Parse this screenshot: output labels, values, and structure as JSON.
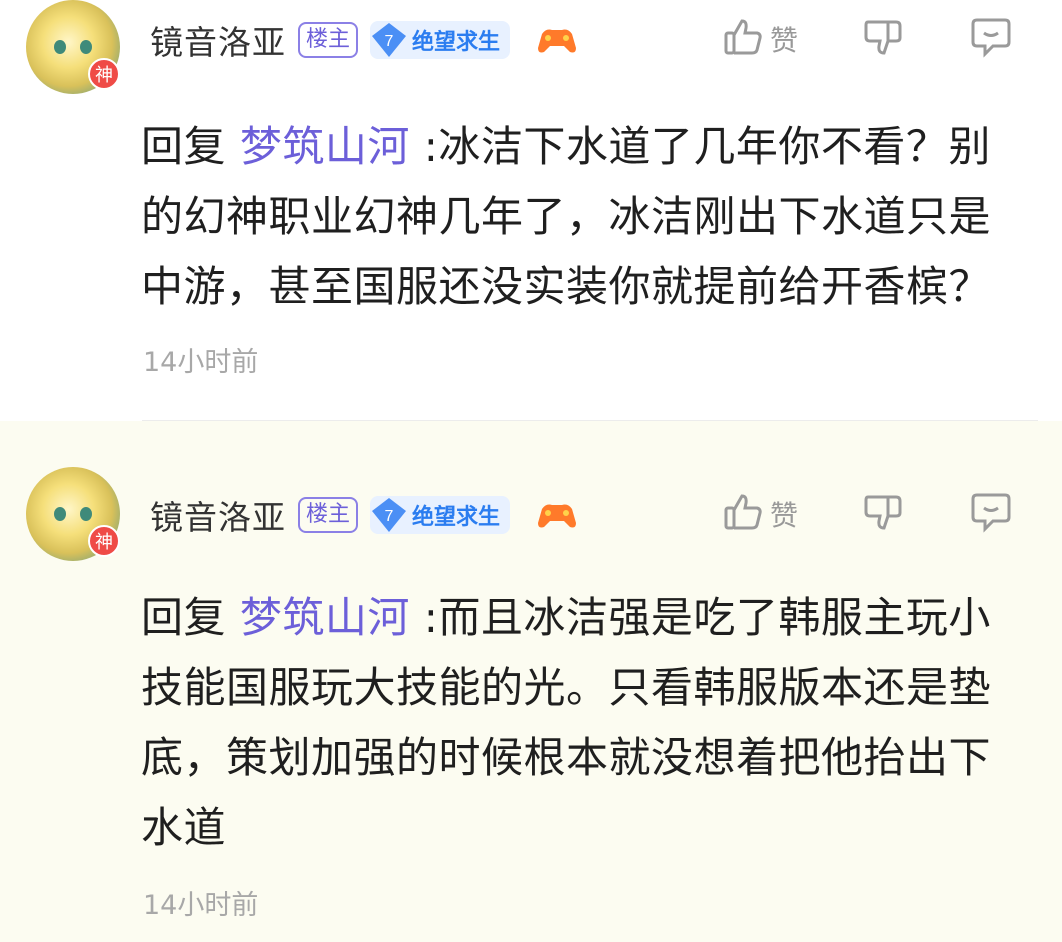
{
  "replies": [
    {
      "username": "镜音洛亚",
      "avatar_badge": "神",
      "owner_tag": "楼主",
      "level_number": "7",
      "level_name": "绝望求生",
      "like_label": "赞",
      "reply_prefix": "回复",
      "mention": "梦筑山河",
      "text": ":冰洁下水道了几年你不看？别的幻神职业幻神几年了，冰洁刚出下水道只是中游，甚至国服还没实装你就提前给开香槟？",
      "time": "14小时前"
    },
    {
      "username": "镜音洛亚",
      "avatar_badge": "神",
      "owner_tag": "楼主",
      "level_number": "7",
      "level_name": "绝望求生",
      "like_label": "赞",
      "reply_prefix": "回复",
      "mention": "梦筑山河",
      "text": ":而且冰洁强是吃了韩服主玩小技能国服玩大技能的光。只看韩服版本还是垫底，策划加强的时候根本就没想着把他抬出下水道",
      "time": "14小时前"
    }
  ],
  "colors": {
    "accent": "#6c5fd9",
    "level": "#2b7df0",
    "badge": "#ef4b47",
    "second_bg": "#fcfcf1"
  },
  "icons": [
    "thumbs-up-icon",
    "thumbs-down-icon",
    "comment-icon",
    "gamepad-icon",
    "level-diamond-icon"
  ]
}
